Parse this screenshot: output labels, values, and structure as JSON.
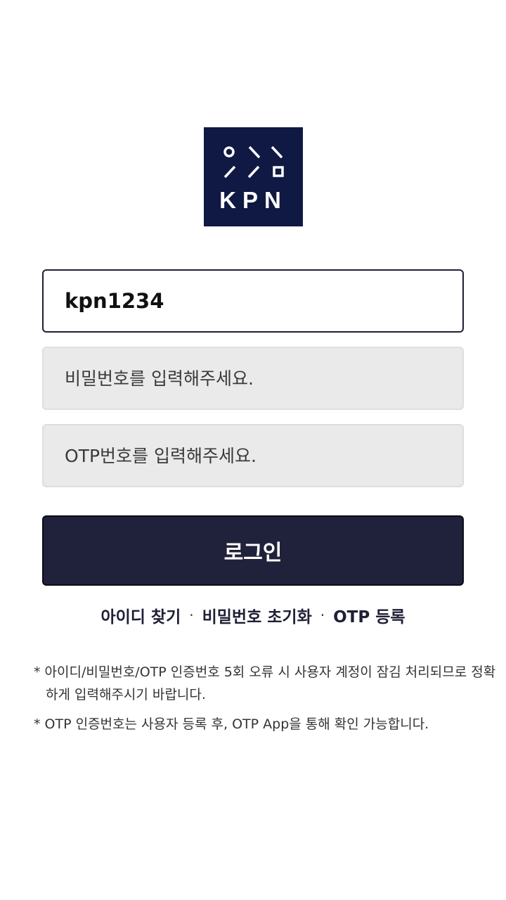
{
  "logo": {
    "text": "KPN",
    "color": "#0f1943"
  },
  "form": {
    "id_value": "kpn1234",
    "password_placeholder": "비밀번호를 입력해주세요.",
    "otp_placeholder": "OTP번호를 입력해주세요."
  },
  "login_button": {
    "label": "로그인",
    "color": "#20213a"
  },
  "links": {
    "find_id": "아이디 찾기",
    "reset_password": "비밀번호 초기화",
    "otp_register": "OTP 등록",
    "separator": "·"
  },
  "notices": [
    "* 아이디/비밀번호/OTP 인증번호 5회 오류 시 사용자 계정이 잠김 처리되므로 정확하게 입력해주시기 바랍니다.",
    "* OTP 인증번호는 사용자 등록 후, OTP App을 통해 확인 가능합니다."
  ]
}
